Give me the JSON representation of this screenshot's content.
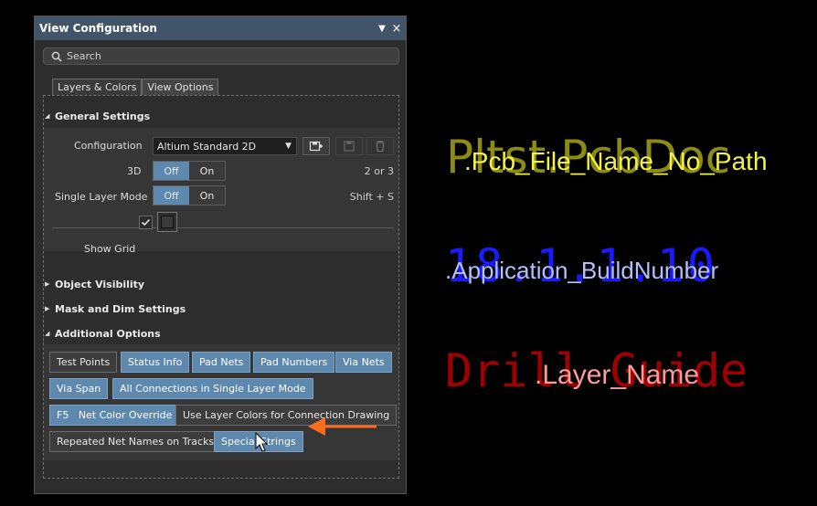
{
  "panel": {
    "title": "View Configuration",
    "search_placeholder": "Search",
    "tabs": [
      {
        "label": "Layers & Colors"
      },
      {
        "label": "View Options"
      }
    ],
    "general_settings": {
      "header": "General Settings",
      "configuration_label": "Configuration",
      "configuration_value": "Altium Standard 2D",
      "threed_label": "3D",
      "threed_shortcut": "2 or 3",
      "single_layer_label": "Single Layer Mode",
      "single_layer_shortcut": "Shift + S",
      "off_label": "Off",
      "on_label": "On",
      "show_grid_label": "Show Grid",
      "show_grid_checked": true
    },
    "object_visibility": "Object Visibility",
    "mask_dim": "Mask and Dim Settings",
    "additional_options": {
      "header": "Additional Options",
      "buttons": [
        {
          "label": "Test Points",
          "selected": false
        },
        {
          "label": "Status Info",
          "selected": true
        },
        {
          "label": "Pad Nets",
          "selected": true
        },
        {
          "label": "Pad Numbers",
          "selected": true
        },
        {
          "label": "Via Nets",
          "selected": true
        },
        {
          "label": "Via Span",
          "selected": true
        },
        {
          "label": "All Connections in Single Layer Mode",
          "selected": true
        },
        {
          "label": "F5   Net Color Override",
          "selected": true
        },
        {
          "label": "Use Layer Colors for Connection Drawing",
          "selected": false
        },
        {
          "label": "Repeated Net Names on Tracks",
          "selected": false
        },
        {
          "label": "Special Strings",
          "selected": true
        }
      ]
    }
  },
  "canvas": {
    "pcb_name_value": "Pltst.PcbDoc",
    "pcb_name_string": ".Pcb_File_Name_No_Path",
    "build_number_value": "18.1.1.10",
    "build_number_string": ".Application_BuildNumber",
    "layer_name_value": "Drill Guide",
    "layer_name_string": ".Layer_Name"
  },
  "colors": {
    "title_bar": "#41546a",
    "selected_button": "#5e88ad",
    "arrow": "#ff6b1a",
    "pcb_name_value": "#8c8c12",
    "pcb_name_string": "#f2f24a",
    "build_number_value": "#1a1aff",
    "layer_name_value": "#a00000"
  }
}
